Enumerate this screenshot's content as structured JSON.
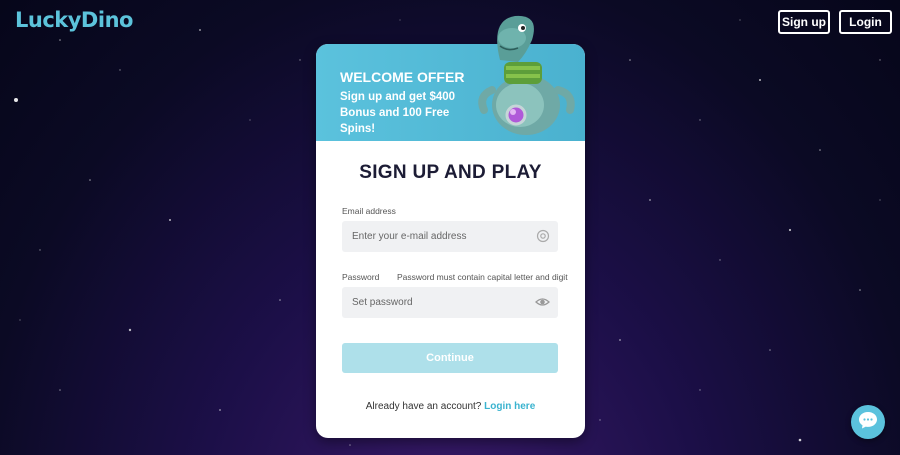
{
  "header": {
    "logo": "LuckyDino",
    "signup_label": "Sign up",
    "login_label": "Login"
  },
  "banner": {
    "title": "WELCOME OFFER",
    "line1": "Sign up and get $400",
    "line2": "Bonus and 100 Free Spins!"
  },
  "form": {
    "title": "SIGN UP AND PLAY",
    "email_label": "Email address",
    "email_placeholder": "Enter your e-mail address",
    "password_label": "Password",
    "password_hint": "Password must contain capital letter and digit",
    "password_placeholder": "Set password",
    "continue_label": "Continue",
    "already_text": "Already have an account?",
    "login_link": "Login here"
  },
  "icons": {
    "email": "at-icon",
    "password": "eye-icon",
    "chat": "chat-icon"
  },
  "colors": {
    "accent": "#5bc2dd",
    "continue_disabled": "#aee0ea",
    "link": "#3ab3cf"
  }
}
